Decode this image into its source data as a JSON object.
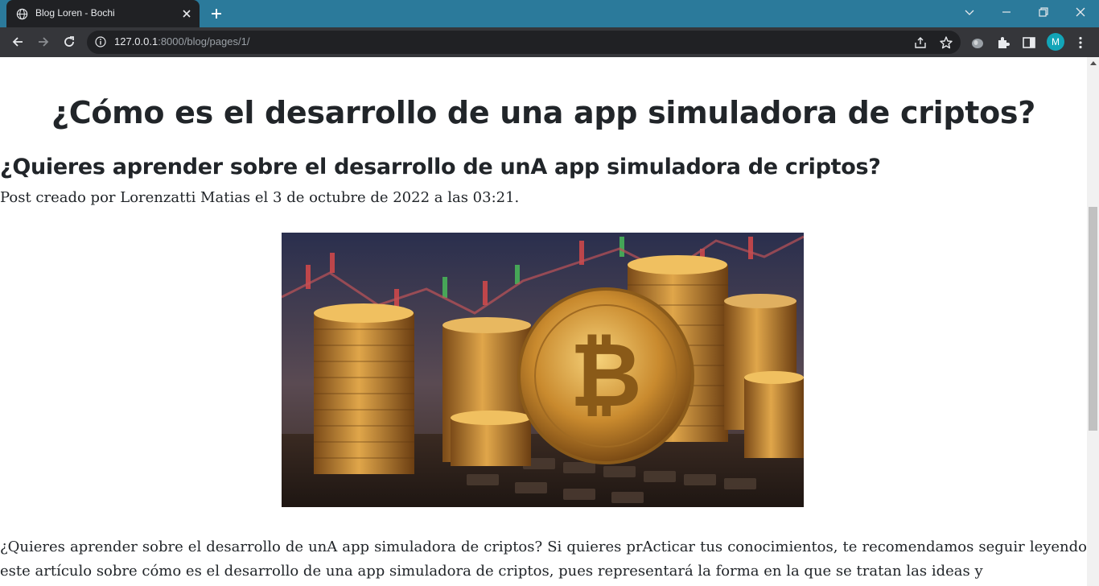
{
  "browser": {
    "tab_title": "Blog Loren - Bochi",
    "url_host": "127.0.0.1",
    "url_rest": ":8000/blog/pages/1/",
    "profile_initial": "M",
    "colors": {
      "tabstrip": "#2b7a9b",
      "toolbar": "#35363a",
      "avatar": "#12a5b8"
    }
  },
  "article": {
    "title": "¿Cómo es el desarrollo de una app simuladora de criptos?",
    "subtitle": "¿Quieres aprender sobre el desarrollo de unA app simuladora de criptos?",
    "meta": "Post creado por Lorenzatti Matias el 3 de octubre de 2022 a las 03:21.",
    "image_icon": "bitcoin-coins-image",
    "body": "¿Quieres aprender sobre el desarrollo de unA app simuladora de criptos? Si quieres prActicar tus conocimientos, te recomendamos seguir leyendo este artículo sobre cómo es el desarrollo de una app simuladora de criptos, pues representará la forma en la que se tratan las ideas y"
  }
}
